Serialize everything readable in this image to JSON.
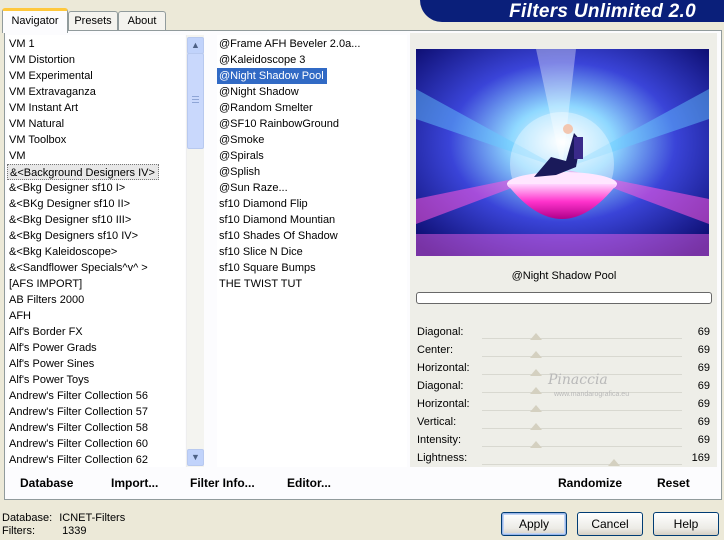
{
  "header": {
    "title": "Filters Unlimited 2.0"
  },
  "tabs": [
    {
      "label": "Navigator",
      "active": true
    },
    {
      "label": "Presets",
      "active": false
    },
    {
      "label": "About",
      "active": false
    }
  ],
  "categories": {
    "items": [
      "VM 1",
      "VM Distortion",
      "VM Experimental",
      "VM Extravaganza",
      "VM Instant Art",
      "VM Natural",
      "VM Toolbox",
      "VM",
      "&<Background Designers IV>",
      "&<Bkg Designer sf10 I>",
      "&<BKg Designer sf10 II>",
      "&<Bkg Designer sf10 III>",
      "&<Bkg Designers sf10 IV>",
      "&<Bkg Kaleidoscope>",
      "&<Sandflower Specials^v^ >",
      "[AFS IMPORT]",
      "AB Filters 2000",
      "AFH",
      "Alf's Border FX",
      "Alf's Power Grads",
      "Alf's Power Sines",
      "Alf's Power Toys",
      "Andrew's Filter Collection 56",
      "Andrew's Filter Collection 57",
      "Andrew's Filter Collection 58",
      "Andrew's Filter Collection 60",
      "Andrew's Filter Collection 62"
    ],
    "selected_index": 8
  },
  "filters": {
    "items": [
      "@Frame AFH Beveler 2.0a...",
      "@Kaleidoscope 3",
      "@Night Shadow Pool",
      "@Night Shadow",
      "@Random Smelter",
      "@SF10 RainbowGround",
      "@Smoke",
      "@Spirals",
      "@Splish",
      "@Sun Raze...",
      "sf10 Diamond Flip",
      "sf10 Diamond Mountian",
      "sf10 Shades Of Shadow",
      "sf10 Slice N Dice",
      "sf10 Square Bumps",
      "THE TWIST TUT"
    ],
    "selected_index": 2
  },
  "preview": {
    "filter_name": "@Night Shadow Pool",
    "watermark": "Pinaccia",
    "watermark_url": "www.mandarografica.eu"
  },
  "sliders": [
    {
      "label": "Diagonal:",
      "value": "69",
      "level": 0.27
    },
    {
      "label": "Center:",
      "value": "69",
      "level": 0.27
    },
    {
      "label": "Horizontal:",
      "value": "69",
      "level": 0.27
    },
    {
      "label": "Diagonal:",
      "value": "69",
      "level": 0.27
    },
    {
      "label": "Horizontal:",
      "value": "69",
      "level": 0.27
    },
    {
      "label": "Vertical:",
      "value": "69",
      "level": 0.27
    },
    {
      "label": "Intensity:",
      "value": "69",
      "level": 0.27
    },
    {
      "label": "Lightness:",
      "value": "169",
      "level": 0.66
    }
  ],
  "actions": {
    "database": "Database",
    "import": "Import...",
    "filter_info": "Filter Info...",
    "editor": "Editor...",
    "randomize": "Randomize",
    "reset": "Reset"
  },
  "buttons": {
    "apply": "Apply",
    "cancel": "Cancel",
    "help": "Help"
  },
  "status": {
    "database_label": "Database:",
    "database_value": "ICNET-Filters",
    "filters_label": "Filters:",
    "filters_value": "1339"
  }
}
